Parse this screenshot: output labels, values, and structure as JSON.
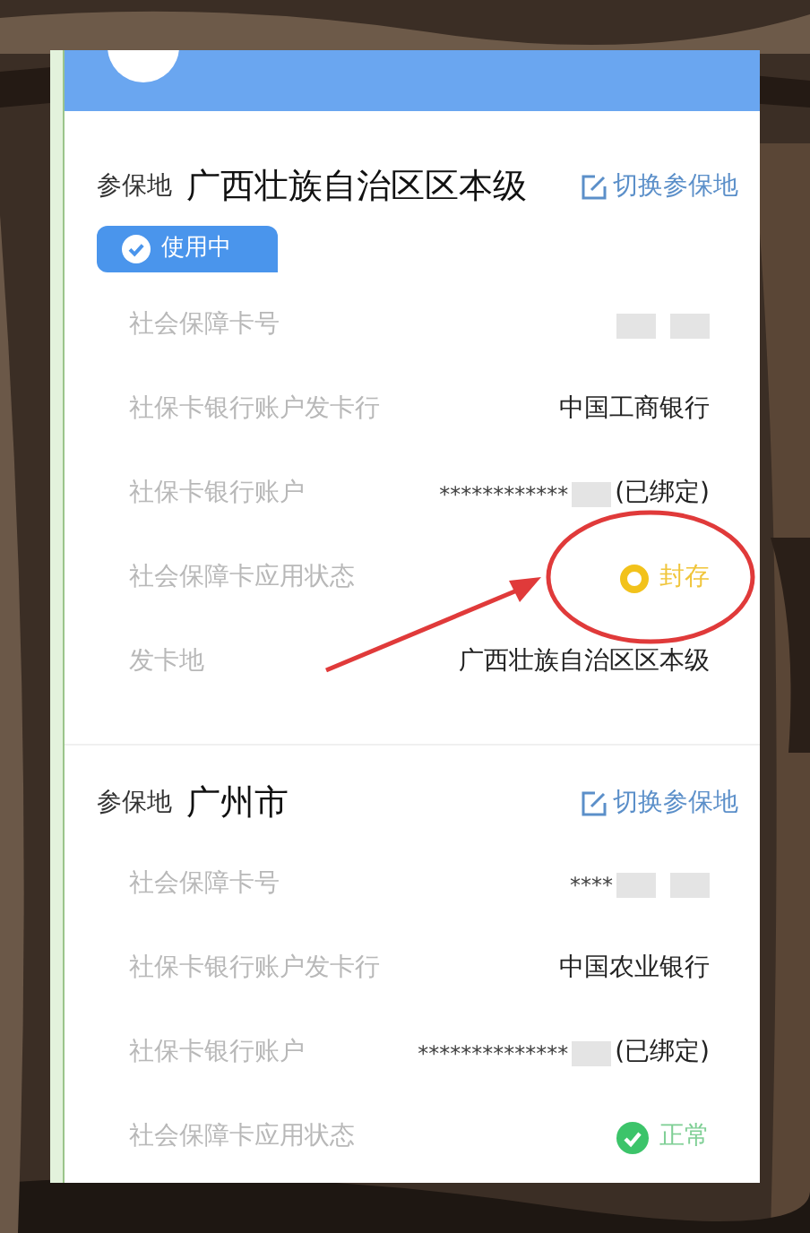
{
  "sections": [
    {
      "insured_place_label": "参保地",
      "insured_place": "广西壮族自治区区本级",
      "switch_link": "切换参保地",
      "status_badge": "使用中",
      "rows": [
        {
          "label": "社会保障卡号",
          "kind": "masked"
        },
        {
          "label": "社保卡银行账户发卡行",
          "kind": "text",
          "value": "中国工商银行"
        },
        {
          "label": "社保卡银行账户",
          "kind": "masked",
          "value": "************",
          "masked_tail": "(已绑定)"
        },
        {
          "label": "社会保障卡应用状态",
          "kind": "status",
          "sealed": true,
          "value": "封存"
        },
        {
          "label": "发卡地",
          "kind": "text",
          "value": "广西壮族自治区区本级"
        }
      ]
    },
    {
      "insured_place_label": "参保地",
      "insured_place": "广州市",
      "switch_link": "切换参保地",
      "rows": [
        {
          "label": "社会保障卡号",
          "kind": "masked",
          "value": "****"
        },
        {
          "label": "社保卡银行账户发卡行",
          "kind": "text",
          "value": "中国农业银行"
        },
        {
          "label": "社保卡银行账户",
          "kind": "masked",
          "value": "**************",
          "masked_tail": "(已绑定)"
        },
        {
          "label": "社会保障卡应用状态",
          "kind": "status",
          "sealed": false,
          "value": "正常"
        }
      ]
    }
  ]
}
